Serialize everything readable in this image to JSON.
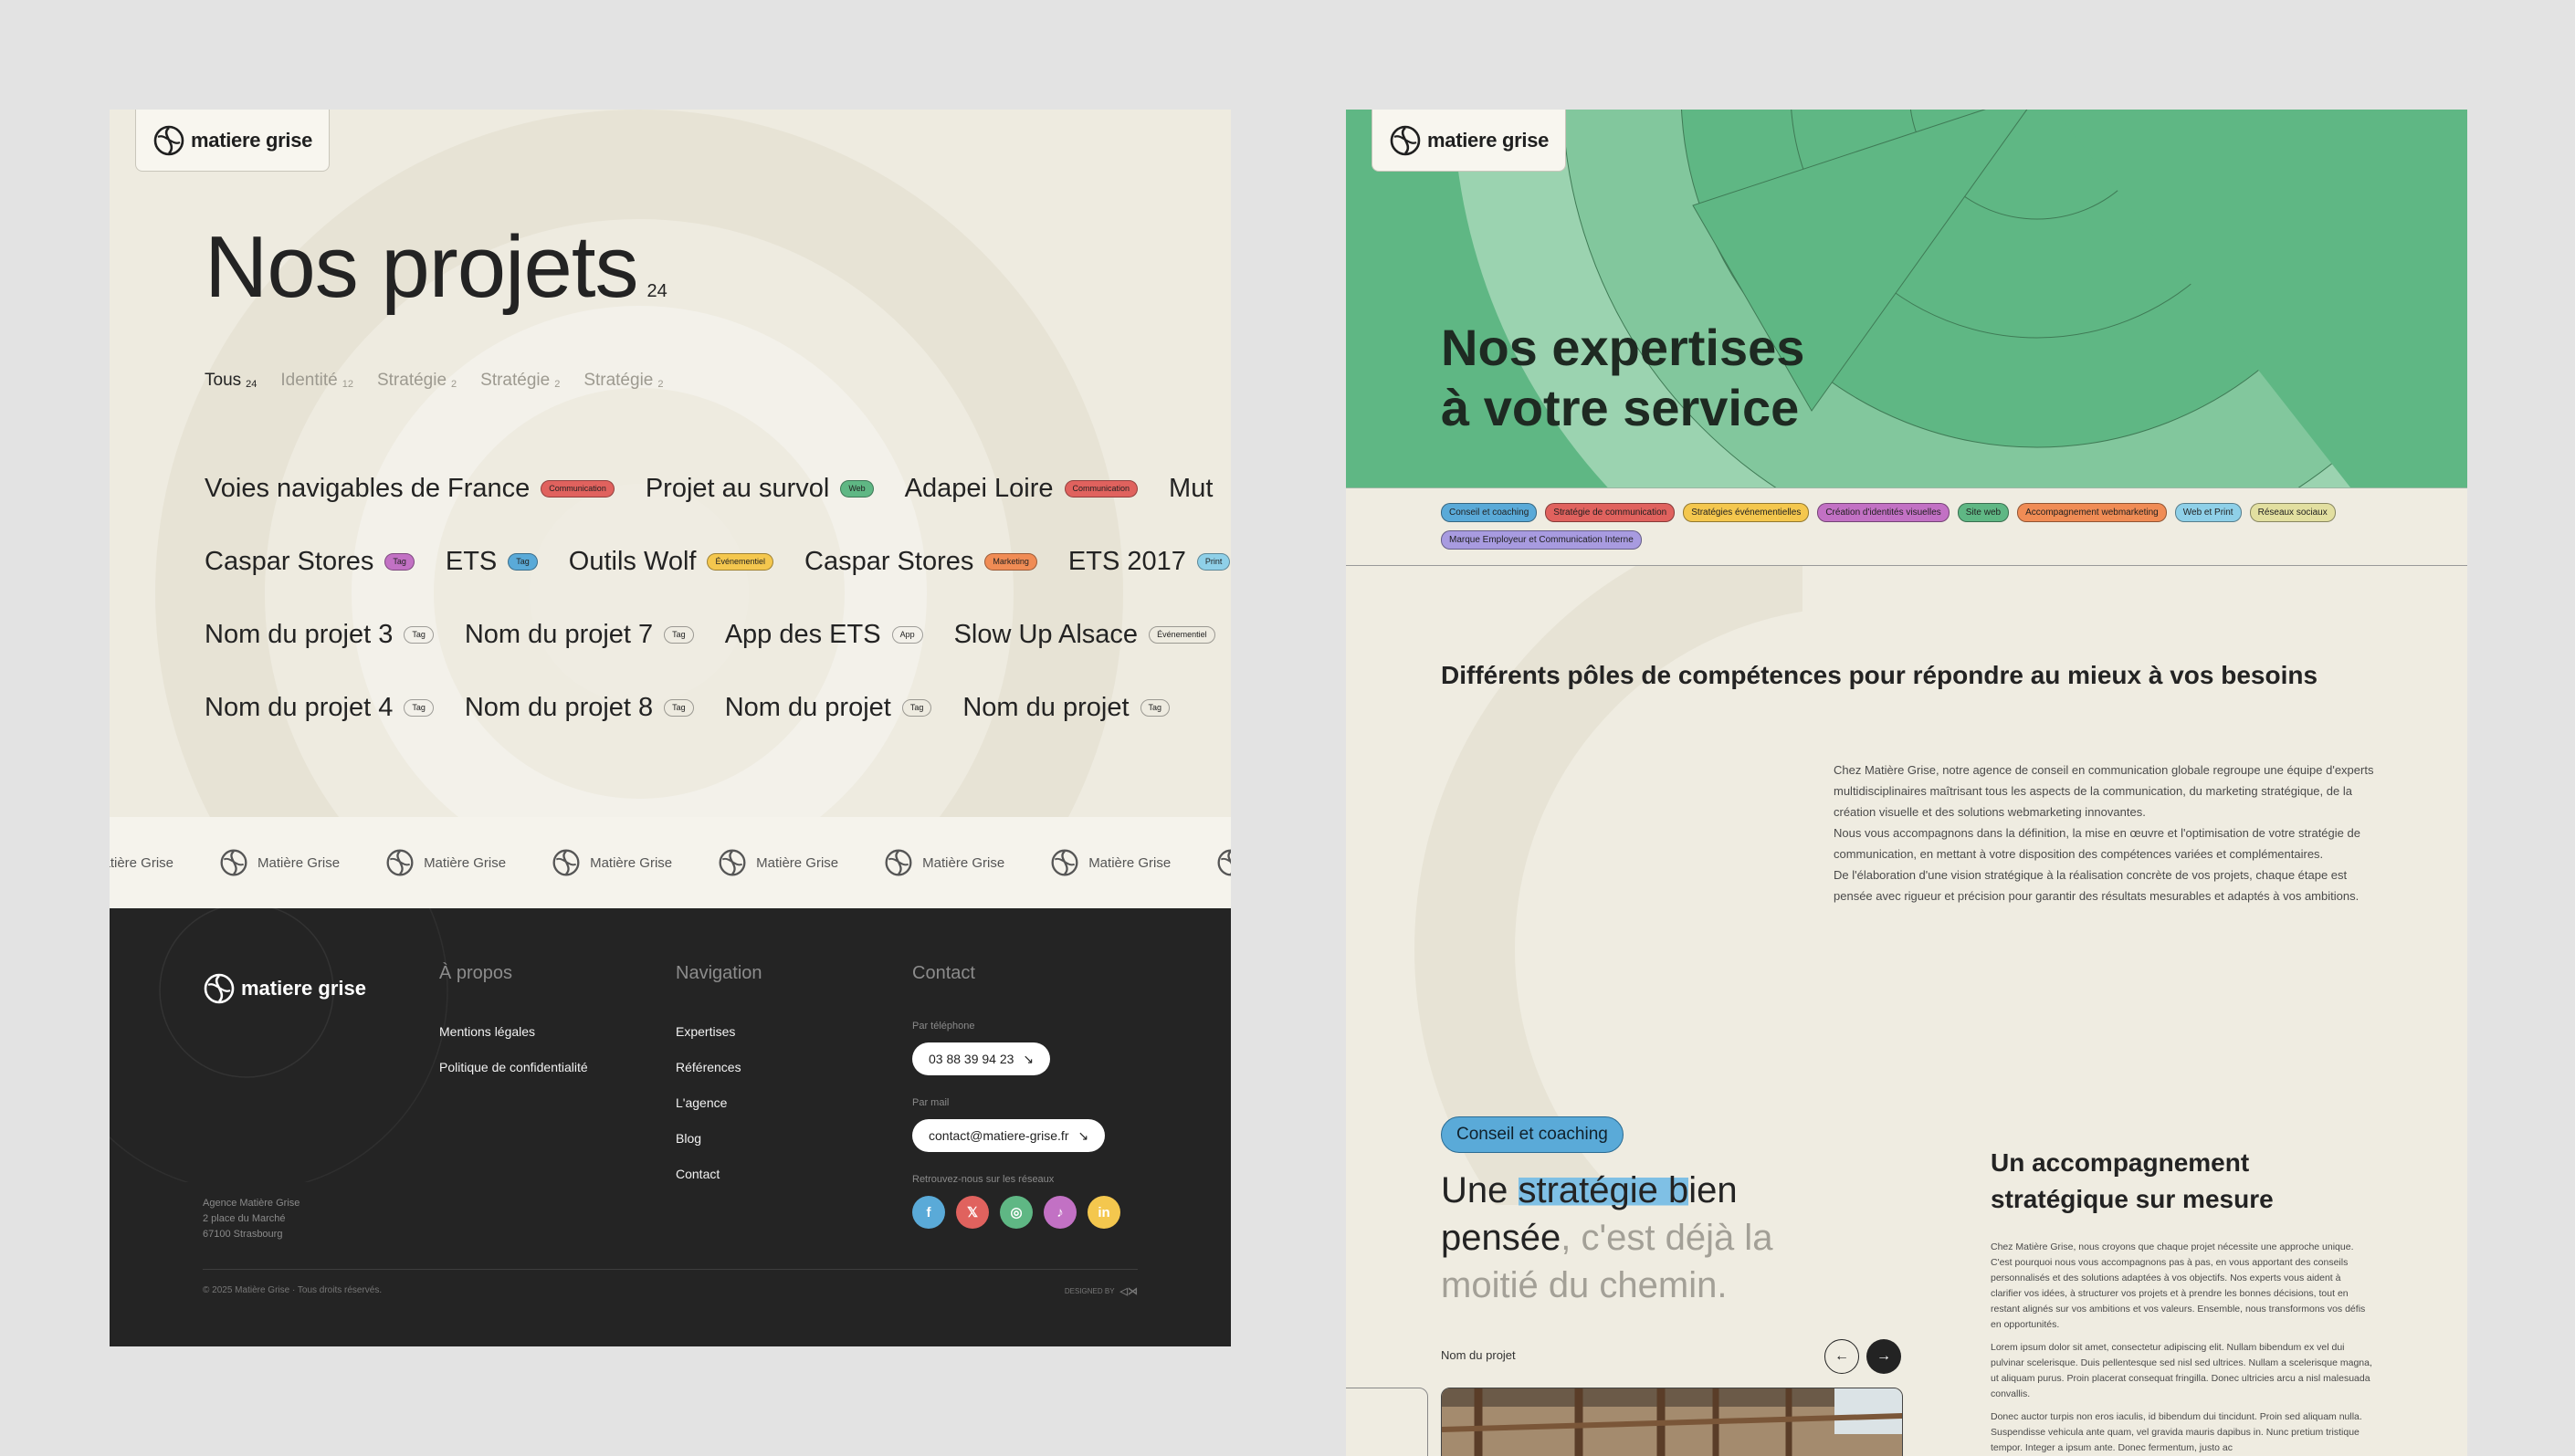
{
  "brand": {
    "name": "matiere grise",
    "marquee_name": "Matière Grise"
  },
  "projects_page": {
    "title": "Nos projets",
    "count": "24",
    "filters": [
      {
        "label": "Tous",
        "count": "24",
        "active": true
      },
      {
        "label": "Identité",
        "count": "12",
        "active": false
      },
      {
        "label": "Stratégie",
        "count": "2",
        "active": false
      },
      {
        "label": "Stratégie",
        "count": "2",
        "active": false
      },
      {
        "label": "Stratégie",
        "count": "2",
        "active": false
      }
    ],
    "rows": [
      [
        {
          "name": "Voies navigables de France",
          "tag": "Communication",
          "tag_color": "#e0625e"
        },
        {
          "name": "Projet au survol",
          "tag": "Web",
          "tag_color": "#5fb784"
        },
        {
          "name": "Adapei Loire",
          "tag": "Communication",
          "tag_color": "#e0625e"
        },
        {
          "name": "Mut",
          "tag": "",
          "tag_color": ""
        }
      ],
      [
        {
          "name": "Caspar Stores",
          "tag": "Tag",
          "tag_color": "#c271c4"
        },
        {
          "name": "ETS",
          "tag": "Tag",
          "tag_color": "#5aaad8"
        },
        {
          "name": "Outils Wolf",
          "tag": "Événementiel",
          "tag_color": "#f4c74e"
        },
        {
          "name": "Caspar Stores",
          "tag": "Marketing",
          "tag_color": "#f08c55"
        },
        {
          "name": "ETS 2017",
          "tag": "Print",
          "tag_color": "#8fd0e8"
        }
      ],
      [
        {
          "name": "Nom du projet 3",
          "tag": "Tag",
          "tag_color": ""
        },
        {
          "name": "Nom du projet 7",
          "tag": "Tag",
          "tag_color": ""
        },
        {
          "name": "App des ETS",
          "tag": "App",
          "tag_color": ""
        },
        {
          "name": "Slow Up Alsace",
          "tag": "Événementiel",
          "tag_color": ""
        }
      ],
      [
        {
          "name": "Nom du projet 4",
          "tag": "Tag",
          "tag_color": ""
        },
        {
          "name": "Nom du projet 8",
          "tag": "Tag",
          "tag_color": ""
        },
        {
          "name": "Nom du projet",
          "tag": "Tag",
          "tag_color": ""
        },
        {
          "name": "Nom du projet",
          "tag": "Tag",
          "tag_color": ""
        }
      ]
    ]
  },
  "footer": {
    "about": {
      "title": "À propos",
      "links": [
        "Mentions légales",
        "Politique de confidentialité"
      ]
    },
    "navigation": {
      "title": "Navigation",
      "links": [
        "Expertises",
        "Références",
        "L'agence",
        "Blog",
        "Contact"
      ]
    },
    "contact": {
      "title": "Contact",
      "phone_label": "Par téléphone",
      "phone": "03 88 39 94 23",
      "mail_label": "Par mail",
      "mail": "contact@matiere-grise.fr",
      "social_label": "Retrouvez-nous sur les réseaux",
      "socials": [
        {
          "icon": "facebook-icon",
          "glyph": "f",
          "color": "#5aaad8"
        },
        {
          "icon": "x-icon",
          "glyph": "𝕏",
          "color": "#e0625e"
        },
        {
          "icon": "instagram-icon",
          "glyph": "◎",
          "color": "#5fb784"
        },
        {
          "icon": "tiktok-icon",
          "glyph": "♪",
          "color": "#c271c4"
        },
        {
          "icon": "linkedin-icon",
          "glyph": "in",
          "color": "#f4c74e"
        }
      ]
    },
    "address": [
      "Agence Matière Grise",
      "2 place du Marché",
      "67100 Strasbourg"
    ],
    "copyright": "© 2025 Matière Grise · Tous droits réservés.",
    "designed_by": "DESIGNED BY"
  },
  "expertises_page": {
    "title_line1": "Nos expertises",
    "title_line2": "à votre service",
    "tags": [
      {
        "label": "Conseil et coaching",
        "color": "#5aaad8"
      },
      {
        "label": "Stratégie de communication",
        "color": "#e0625e"
      },
      {
        "label": "Stratégies événementielles",
        "color": "#f4c74e"
      },
      {
        "label": "Création d'identités visuelles",
        "color": "#c271c4"
      },
      {
        "label": "Site web",
        "color": "#5fb784"
      },
      {
        "label": "Accompagnement webmarketing",
        "color": "#f08c55"
      },
      {
        "label": "Web et Print",
        "color": "#8fd0e8"
      },
      {
        "label": "Réseaux sociaux",
        "color": "#e2dfa0"
      },
      {
        "label": "Marque Employeur et Communication Interne",
        "color": "#a89be0"
      }
    ],
    "poles_title": "Différents pôles de compétences pour répondre au mieux à vos besoins",
    "intro": [
      "Chez Matière Grise, notre agence de conseil en communication globale regroupe une équipe d'experts multidisciplinaires maîtrisant tous les aspects de la communication, du marketing stratégique, de la création visuelle et des solutions webmarketing innovantes.",
      "Nous vous accompagnons dans la définition, la mise en œuvre et l'optimisation de votre stratégie de communication, en mettant à votre disposition des compétences variées et complémentaires.",
      "De l'élaboration d'une vision stratégique à la réalisation concrète de vos projets, chaque étape est pensée avec rigueur et précision pour garantir des résultats mesurables et adaptés à vos ambitions."
    ],
    "service": {
      "tag": "Conseil et coaching",
      "slogan_a": "Une ",
      "slogan_highlight": "stratégie b",
      "slogan_b": "ien pensée",
      "slogan_muted": ", c'est déjà la moitié du chemin.",
      "project_label": "Nom du projet",
      "acc_title": "Un accompagnement stratégique sur mesure",
      "acc_paragraphs": [
        "Chez Matière Grise, nous croyons que chaque projet nécessite une approche unique. C'est pourquoi nous vous accompagnons pas à pas, en vous apportant des conseils personnalisés et des solutions adaptées à vos objectifs. Nos experts vous aident à clarifier vos idées, à structurer vos projets et à prendre les bonnes décisions, tout en restant alignés sur vos ambitions et vos valeurs. Ensemble, nous transformons vos défis en opportunités.",
        "Lorem ipsum dolor sit amet, consectetur adipiscing elit. Nullam bibendum ex vel dui pulvinar scelerisque. Duis pellentesque sed nisl sed ultrices. Nullam a scelerisque magna, ut aliquam purus. Proin placerat consequat fringilla. Donec ultricies arcu a nisl malesuada convallis.",
        "Donec auctor turpis non eros iaculis, id bibendum dui tincidunt. Proin sed aliquam nulla. Suspendisse vehicula ante quam, vel gravida mauris dapibus in. Nunc pretium tristique tempor. Integer a ipsum ante. Donec fermentum, justo ac"
      ]
    }
  }
}
